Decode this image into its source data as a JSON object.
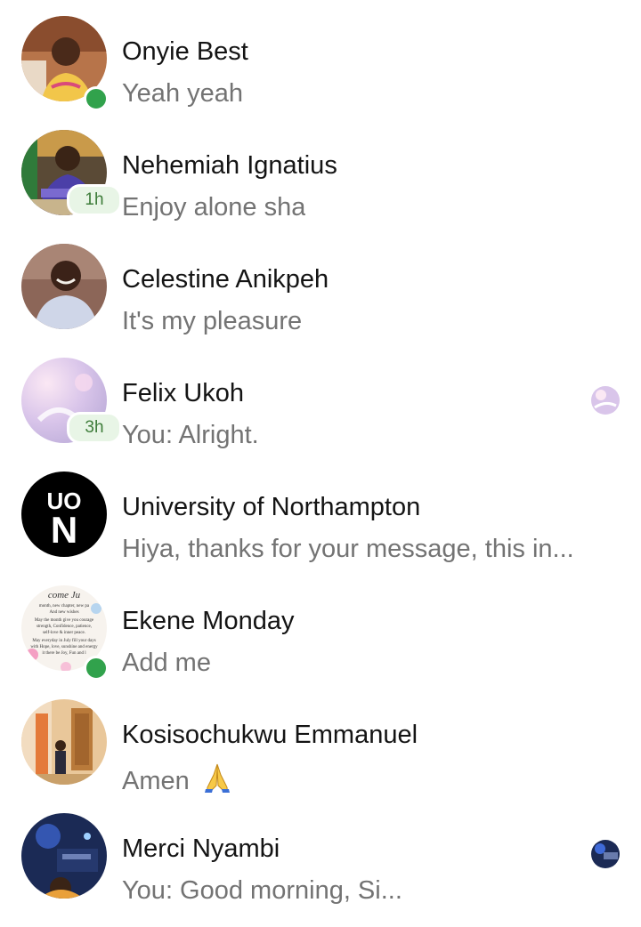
{
  "conversations": [
    {
      "name": "Onyie Best",
      "preview": "Yeah yeah",
      "status": "online"
    },
    {
      "name": "Nehemiah Ignatius",
      "preview": "Enjoy alone sha",
      "status": "1h"
    },
    {
      "name": "Celestine Anikpeh",
      "preview": "It's my pleasure",
      "status": ""
    },
    {
      "name": "Felix Ukoh",
      "preview": "You: Alright.",
      "status": "3h",
      "seen": true
    },
    {
      "name": "University of Northampton",
      "preview": "Hiya, thanks for your message, this in...",
      "status": "",
      "logo_top": "UO",
      "logo_bottom": "N"
    },
    {
      "name": "Ekene Monday",
      "preview": "Add me",
      "status": "online",
      "avatar_text": [
        "come Ju",
        "month, new chapter, new pa",
        "And new wishes",
        "May the month give you courage",
        "strength, Confidence, patience,",
        "self-love & inner peace.",
        "May everyday in July fill your days",
        "with Hope, love, sunshine and energy",
        "it there be Joy, Fun and l"
      ]
    },
    {
      "name": "Kosisochukwu Emmanuel",
      "preview": "Amen",
      "status": "",
      "emoji": "folded-hands-icon"
    },
    {
      "name": "Merci Nyambi",
      "preview": "You: Good morning, Si...",
      "status": "",
      "seen": true
    }
  ],
  "colors": {
    "name_text": "#141414",
    "preview_text": "#737373",
    "online_green": "#31a24c",
    "badge_bg": "#e8f5e6",
    "badge_text": "#3e7d3a"
  }
}
